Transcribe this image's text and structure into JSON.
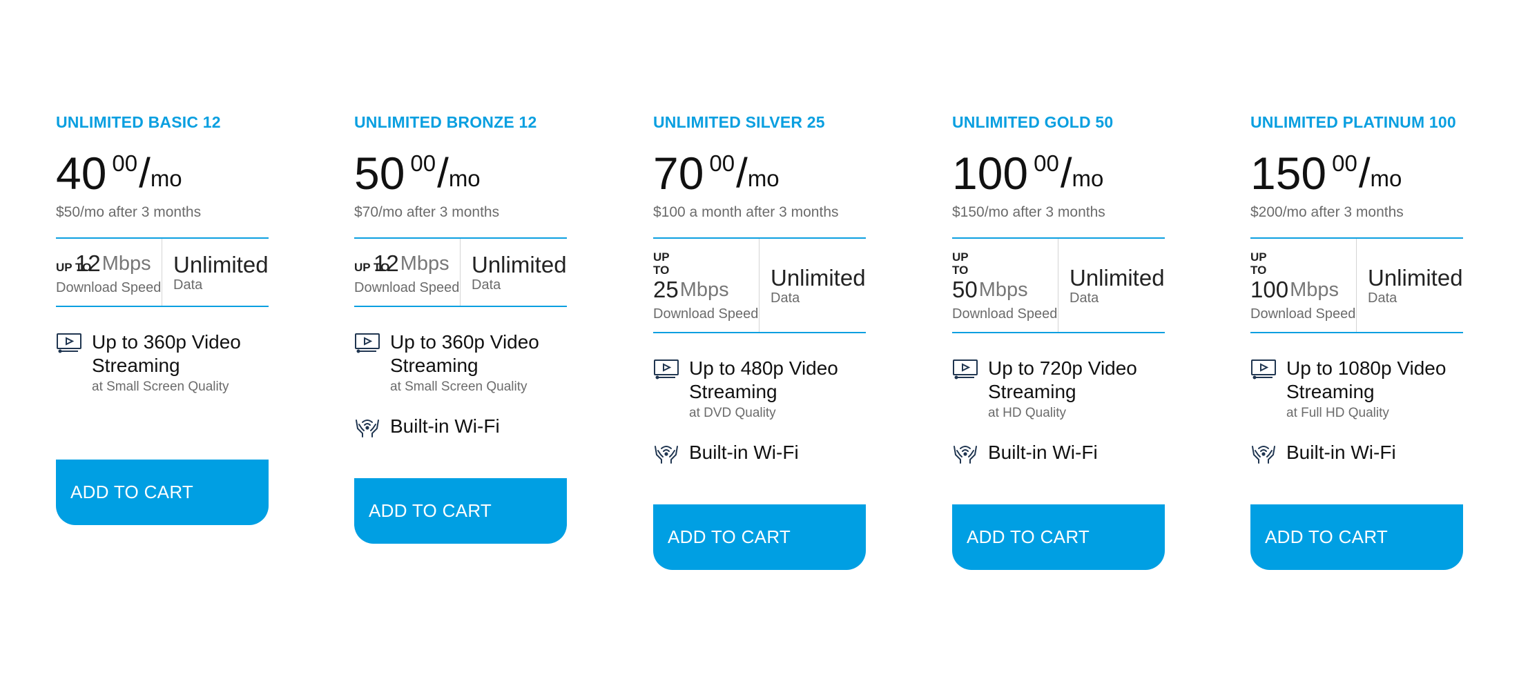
{
  "plans": [
    {
      "name": "UNLIMITED BASIC 12",
      "price_dollars": "40",
      "price_cents": "00",
      "price_slash": "/",
      "price_per": "mo",
      "promo_note": "$50/mo after 3 months",
      "speed_upto": "UP TO",
      "speed_value": "12",
      "speed_unit": "Mbps",
      "speed_label": "Download Speed",
      "data_value": "Unlimited",
      "data_label": "Data",
      "video_title": "Up to 360p Video Streaming",
      "video_sub": "at Small Screen Quality",
      "wifi": null,
      "cta": "ADD TO CART"
    },
    {
      "name": "UNLIMITED BRONZE 12",
      "price_dollars": "50",
      "price_cents": "00",
      "price_slash": "/",
      "price_per": "mo",
      "promo_note": "$70/mo after 3 months",
      "speed_upto": "UP TO",
      "speed_value": "12",
      "speed_unit": "Mbps",
      "speed_label": "Download Speed",
      "data_value": "Unlimited",
      "data_label": "Data",
      "video_title": "Up to 360p Video Streaming",
      "video_sub": "at Small Screen Quality",
      "wifi": "Built-in Wi-Fi",
      "cta": "ADD TO CART"
    },
    {
      "name": "UNLIMITED SILVER 25",
      "price_dollars": "70",
      "price_cents": "00",
      "price_slash": "/",
      "price_per": "mo",
      "promo_note": "$100 a month after 3 months",
      "speed_upto": "UP TO",
      "speed_value": "25",
      "speed_unit": "Mbps",
      "speed_label": "Download Speed",
      "data_value": "Unlimited",
      "data_label": "Data",
      "video_title": "Up to 480p Video Streaming",
      "video_sub": "at DVD Quality",
      "wifi": "Built-in Wi-Fi",
      "cta": "ADD TO CART"
    },
    {
      "name": "UNLIMITED GOLD 50",
      "price_dollars": "100",
      "price_cents": "00",
      "price_slash": "/",
      "price_per": "mo",
      "promo_note": "$150/mo after 3 months",
      "speed_upto": "UP TO",
      "speed_value": "50",
      "speed_unit": "Mbps",
      "speed_label": "Download Speed",
      "data_value": "Unlimited",
      "data_label": "Data",
      "video_title": "Up to 720p Video Streaming",
      "video_sub": "at HD Quality",
      "wifi": "Built-in Wi-Fi",
      "cta": "ADD TO CART"
    },
    {
      "name": "UNLIMITED PLATINUM 100",
      "price_dollars": "150",
      "price_cents": "00",
      "price_slash": "/",
      "price_per": "mo",
      "promo_note": "$200/mo after 3 months",
      "speed_upto": "UP TO",
      "speed_value": "100",
      "speed_unit": "Mbps",
      "speed_label": "Download Speed",
      "data_value": "Unlimited",
      "data_label": "Data",
      "video_title": "Up to 1080p Video Streaming",
      "video_sub": "at Full HD Quality",
      "wifi": "Built-in Wi-Fi",
      "cta": "ADD TO CART"
    }
  ],
  "icons": {
    "video": "tv-play-icon",
    "wifi": "wifi-hands-icon"
  },
  "colors": {
    "accent": "#009fe3",
    "plan_name": "#0a9fe0",
    "divider": "#0a9fe0",
    "muted_text": "#6b6b6b",
    "button_text": "#ffffff"
  }
}
